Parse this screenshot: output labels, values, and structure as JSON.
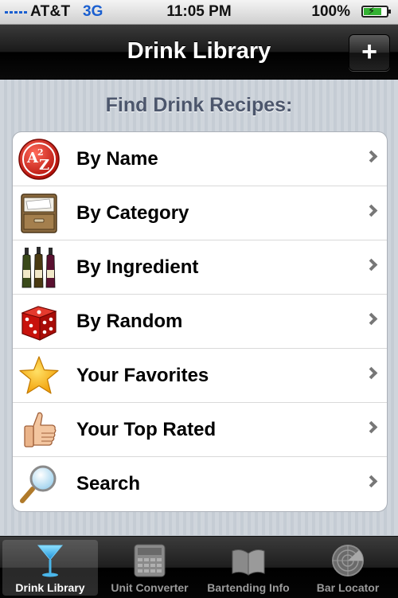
{
  "status_bar": {
    "carrier": "AT&T",
    "network": "3G",
    "time": "11:05 PM",
    "battery_percent": "100%",
    "battery_level": 1.0
  },
  "nav": {
    "title": "Drink Library",
    "add_label": "+"
  },
  "section_header": "Find Drink Recipes:",
  "menu_items": [
    {
      "label": "By Name",
      "icon": "a-to-z-icon"
    },
    {
      "label": "By Category",
      "icon": "file-cabinet-icon"
    },
    {
      "label": "By Ingredient",
      "icon": "bottles-icon"
    },
    {
      "label": "By Random",
      "icon": "dice-icon"
    },
    {
      "label": "Your Favorites",
      "icon": "star-icon"
    },
    {
      "label": "Your Top Rated",
      "icon": "thumbs-up-icon"
    },
    {
      "label": "Search",
      "icon": "magnifier-icon"
    }
  ],
  "tabs": [
    {
      "label": "Drink Library",
      "icon": "martini-glass-icon",
      "selected": true
    },
    {
      "label": "Unit Converter",
      "icon": "calculator-icon",
      "selected": false
    },
    {
      "label": "Bartending Info",
      "icon": "book-icon",
      "selected": false
    },
    {
      "label": "Bar Locator",
      "icon": "radar-icon",
      "selected": false
    }
  ],
  "colors": {
    "network_blue": "#1a5fd0",
    "battery_green": "#34b233",
    "header_text": "#4c566c",
    "background": "#c5ccd4"
  }
}
